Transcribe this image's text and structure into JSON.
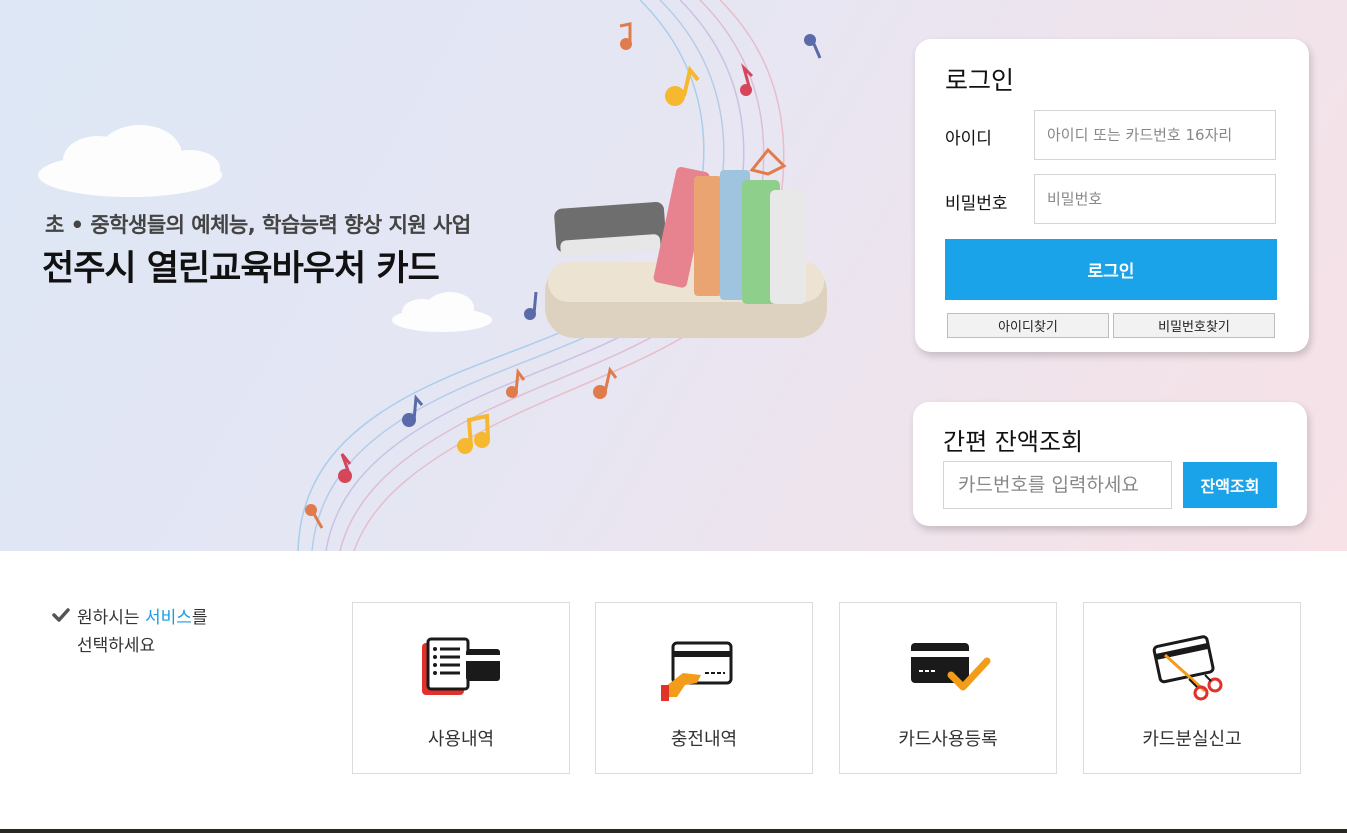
{
  "hero": {
    "subtitle": "초 • 중학생들의 예체능, 학습능력 향상 지원 사업",
    "title": "전주시 열린교육바우처 카드"
  },
  "login": {
    "title": "로그인",
    "id_label": "아이디",
    "id_placeholder": "아이디 또는 카드번호 16자리",
    "password_label": "비밀번호",
    "password_placeholder": "비밀번호",
    "submit_label": "로그인",
    "find_id_label": "아이디찾기",
    "find_password_label": "비밀번호찾기"
  },
  "balance": {
    "title": "간편 잔액조회",
    "placeholder": "카드번호를 입력하세요",
    "button_label": "잔액조회"
  },
  "services": {
    "prompt_line1_prefix": "원하시는 ",
    "prompt_line1_highlight": "서비스",
    "prompt_line1_suffix": "를",
    "prompt_line2": "선택하세요",
    "items": [
      {
        "label": "사용내역",
        "icon": "usage-history-icon"
      },
      {
        "label": "충전내역",
        "icon": "charge-history-icon"
      },
      {
        "label": "카드사용등록",
        "icon": "card-register-icon"
      },
      {
        "label": "카드분실신고",
        "icon": "card-lost-report-icon"
      }
    ]
  },
  "colors": {
    "accent": "#1aa3e8",
    "highlight_text": "#1a9be0",
    "icon_red": "#e0322b",
    "icon_orange": "#f39c1a",
    "icon_dark": "#1a1a1a"
  }
}
